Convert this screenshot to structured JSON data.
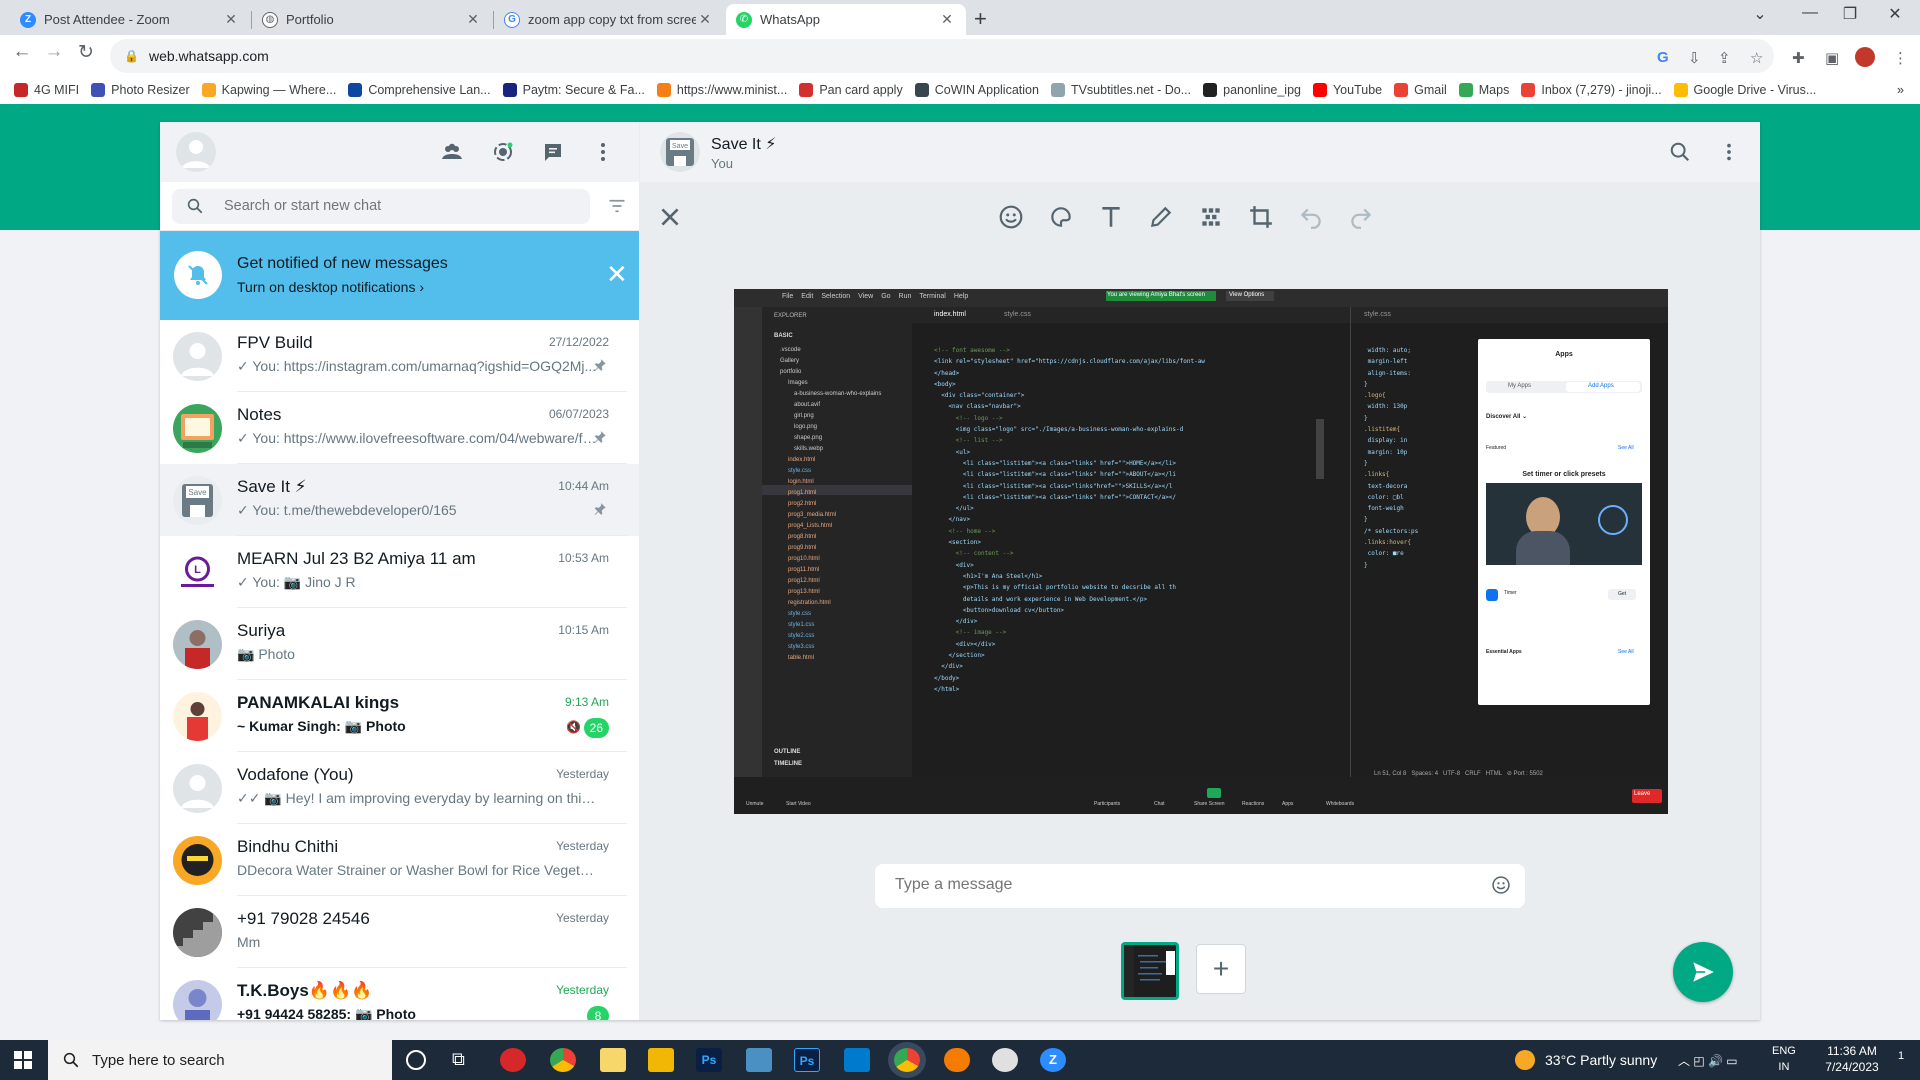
{
  "browser": {
    "tabs": [
      {
        "title": "Post Attendee - Zoom",
        "icon": "zoom-icon",
        "color": "#2d8cff"
      },
      {
        "title": "Portfolio",
        "icon": "globe-icon",
        "color": "#5f6368"
      },
      {
        "title": "zoom app copy txt from screen -",
        "icon": "google-icon",
        "color": "#4285f4"
      },
      {
        "title": "WhatsApp",
        "icon": "whatsapp-icon",
        "color": "#25d366"
      }
    ],
    "url": "web.whatsapp.com",
    "bookmarks": [
      {
        "label": "4G MIFI",
        "color": "#c62828"
      },
      {
        "label": "Photo Resizer",
        "color": "#3f51b5"
      },
      {
        "label": "Kapwing — Where...",
        "color": "#f9a825"
      },
      {
        "label": "Comprehensive Lan...",
        "color": "#0d47a1"
      },
      {
        "label": "Paytm: Secure & Fa...",
        "color": "#1a237e"
      },
      {
        "label": "https://www.minist...",
        "color": "#f57f17"
      },
      {
        "label": "Pan card apply",
        "color": "#d32f2f"
      },
      {
        "label": "CoWIN Application",
        "color": "#37474f"
      },
      {
        "label": "TVsubtitles.net - Do...",
        "color": "#90a4ae"
      },
      {
        "label": "panonline_ipg",
        "color": "#212121"
      },
      {
        "label": "YouTube",
        "color": "#ff0000"
      },
      {
        "label": "Gmail",
        "color": "#ea4335"
      },
      {
        "label": "Maps",
        "color": "#34a853"
      },
      {
        "label": "Inbox (7,279) - jinoji...",
        "color": "#ea4335"
      },
      {
        "label": "Google Drive - Virus...",
        "color": "#fbbc04"
      }
    ],
    "more_bookmarks": "»"
  },
  "whatsapp": {
    "search_placeholder": "Search or start new chat",
    "notification": {
      "title": "Get notified of new messages",
      "link": "Turn on desktop notifications ›"
    },
    "chats": [
      {
        "name": "FPV Build",
        "time": "27/12/2022",
        "message": "✓ You: https://instagram.com/umarnaq?igshid=OGQ2Mj...",
        "pinned": true,
        "avatar": "default"
      },
      {
        "name": "Notes",
        "time": "06/07/2023",
        "message": "✓ You: https://www.ilovefreesoftware.com/04/webware/fr...",
        "pinned": true,
        "avatar": "notes"
      },
      {
        "name": "Save It ⚡",
        "time": "10:44 Am",
        "message": "✓ You: t.me/thewebdeveloper0/165",
        "pinned": true,
        "avatar": "save",
        "selected": true
      },
      {
        "name": "MEARN Jul 23 B2 Amiya 11 am",
        "time": "10:53 Am",
        "message": "✓ You: 📷 Jino J R",
        "avatar": "luminar"
      },
      {
        "name": "Suriya",
        "time": "10:15 Am",
        "message": "📷 Photo",
        "avatar": "photo"
      },
      {
        "name": "PANAMKALAI kings",
        "time": "9:13 Am",
        "message": "~ Kumar Singh: 📷 Photo",
        "unread": "26",
        "muted": true,
        "bold": true,
        "avatar": "group"
      },
      {
        "name": "Vodafone (You)",
        "time": "Yesterday",
        "message": "✓✓ 📷 Hey! I am improving everyday by learning on this am...",
        "avatar": "default"
      },
      {
        "name": "Bindhu Chithi",
        "time": "Yesterday",
        "message": "DDecora Water Strainer or Washer Bowl for Rice Vegetable ...",
        "avatar": "dark"
      },
      {
        "name": "+91 79028 24546",
        "time": "Yesterday",
        "message": "Mm",
        "avatar": "stairs"
      },
      {
        "name": "T.K.Boys🔥🔥🔥",
        "time": "Yesterday",
        "message": "+91 94424 58285: 📷 Photo",
        "unread": "8",
        "bold": true,
        "avatar": "tk"
      }
    ],
    "conversation": {
      "name": "Save It ⚡",
      "subtitle": "You"
    },
    "caption_placeholder": "Type a message",
    "add_label": "+"
  },
  "preview": {
    "menu": [
      "File",
      "Edit",
      "Selection",
      "View",
      "Go",
      "Run",
      "Terminal",
      "Help"
    ],
    "zoom_banner": "You are viewing Amiya Bhat's screen",
    "view_options": "View Options",
    "explorer_title": "EXPLORER",
    "explorer_root": "BASIC",
    "files": [
      ".vscode",
      "Gallery",
      "portfolio",
      "Images",
      "a-business-woman-who-explains",
      "about.avif",
      "girl.png",
      "logo.png",
      "shape.png",
      "skills.webp",
      "index.html",
      "style.css",
      "login.html",
      "prog1.html",
      "prog2.html",
      "prog3_media.html",
      "prog4_Lists.html",
      "prog8.html",
      "prog9.html",
      "prog10.html",
      "prog11.html",
      "prog12.html",
      "prog13.html",
      "registration.html",
      "style.css",
      "style1.css",
      "style2.css",
      "style3.css",
      "table.html"
    ],
    "outline": "OUTLINE",
    "timeline": "TIMELINE",
    "tab1": "index.html",
    "tab2": "style.css",
    "tab3": "style.css",
    "code_lines": [
      "<!-- font awesome -->",
      "<link rel=\"stylesheet\" href=\"https://cdnjs.cloudflare.com/ajax/libs/font-aw",
      "",
      "",
      "</head>",
      "<body>",
      "  <div class=\"container\">",
      "    <nav class=\"navbar\">",
      "      <!-- logo -->",
      "      <img class=\"logo\" src=\"./Images/a-business-woman-who-explains-d",
      "      <!-- list -->",
      "      <ul>",
      "        <li class=\"listitem\"><a class=\"links\" href=\"\">HOME</a></li>",
      "        <li class=\"listitem\"><a class=\"links\" href=\"\">ABOUT</a></li",
      "        <li class=\"listitem\"><a class=\"links\"href=\"\">SKILLS</a></l",
      "        <li class=\"listitem\"><a class=\"links\" href=\"\">CONTACT</a></",
      "      </ul>",
      "    </nav>",
      "",
      "    <!-- home -->",
      "    <section>",
      "",
      "      <!-- content -->",
      "      <div>",
      "        <h1>I'm Ana Steel</h1>",
      "        <p>This is my official portfolio website to decsribe all th",
      "        details and work experience in Web Development.</p>",
      "        <button>download cv</button>",
      "      </div>",
      "      <!-- image -->",
      "      <div></div>",
      "    </section>",
      "  </div>",
      "",
      "</body>",
      "</html>"
    ],
    "css_lines": [
      " width: auto;",
      " margin-left",
      " align-items:",
      "}",
      ".logo{",
      " width: 130p",
      "}",
      ".listitem{",
      " display: in",
      " margin: 10p",
      "}",
      ".links{",
      " text-decora",
      " color: □bl",
      " font-weigh",
      "}",
      "",
      "/* selectors:ps",
      "",
      ".links:hover{",
      " color: ■re",
      "}"
    ],
    "apps_panel": {
      "title": "Apps",
      "tab_my": "My Apps",
      "tab_add": "Add Apps",
      "discover": "Discover All ⌄",
      "featured": "Featured",
      "see_all": "See All",
      "feature_title": "Set timer or click presets",
      "essential": "Essential Apps",
      "timer_name": "Timer",
      "get": "Get"
    },
    "status": "Ln 51, Col 8   Spaces: 4   UTF-8   CRLF   HTML   ⊘ Port : 5502",
    "zoom_controls": [
      "Unmute",
      "Start Video",
      "Participants",
      "Chat",
      "Share Screen",
      "Reactions",
      "Apps",
      "Whiteboards"
    ],
    "leave": "Leave"
  },
  "taskbar": {
    "search_placeholder": "Type here to search",
    "weather": "33°C  Partly sunny",
    "lang": "ENG\nIN",
    "time": "11:36 AM",
    "date": "7/24/2023",
    "notif_count": "1"
  }
}
